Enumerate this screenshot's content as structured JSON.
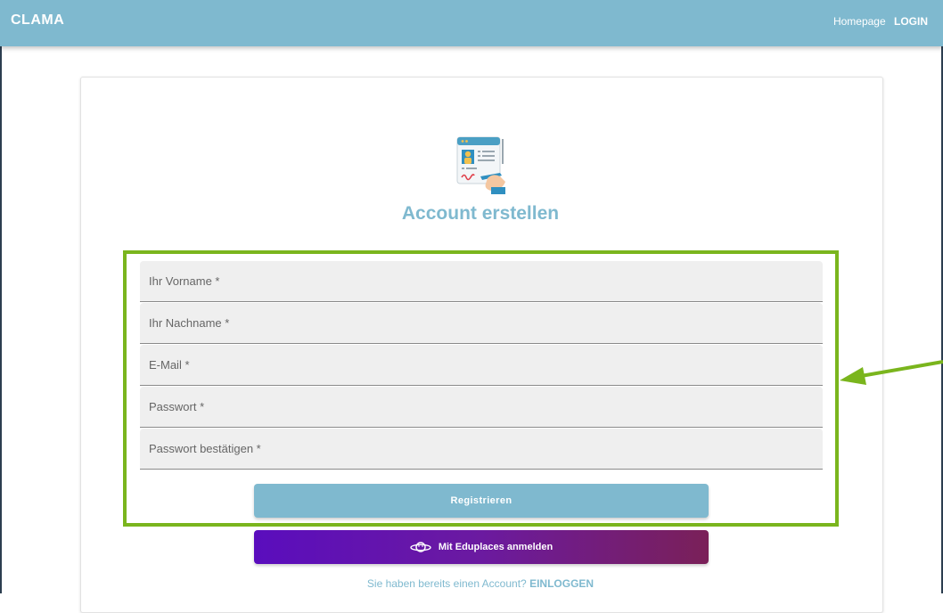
{
  "navbar": {
    "brand": "CLAMA",
    "homepage_label": "Homepage",
    "login_label": "LOGIN",
    "bg_color": "#7fb9cf"
  },
  "main": {
    "title": "Account erstellen",
    "illustration_icon": "signup-document-illustration",
    "fields": [
      {
        "placeholder": "Ihr Vorname *"
      },
      {
        "placeholder": "Ihr Nachname *"
      },
      {
        "placeholder": "E-Mail *"
      },
      {
        "placeholder": "Passwort *"
      },
      {
        "placeholder": "Passwort bestätigen *"
      }
    ],
    "register_label": "Registrieren",
    "eduplaces_label": "Mit Eduplaces anmelden",
    "eduplaces_icon": "planet-icon",
    "login_hint_text": "Sie haben bereits einen Account?",
    "login_hint_link": "EINLOGGEN"
  },
  "annotation": {
    "highlight_color": "#7ab51d",
    "arrow_icon": "arrow-left-icon"
  }
}
